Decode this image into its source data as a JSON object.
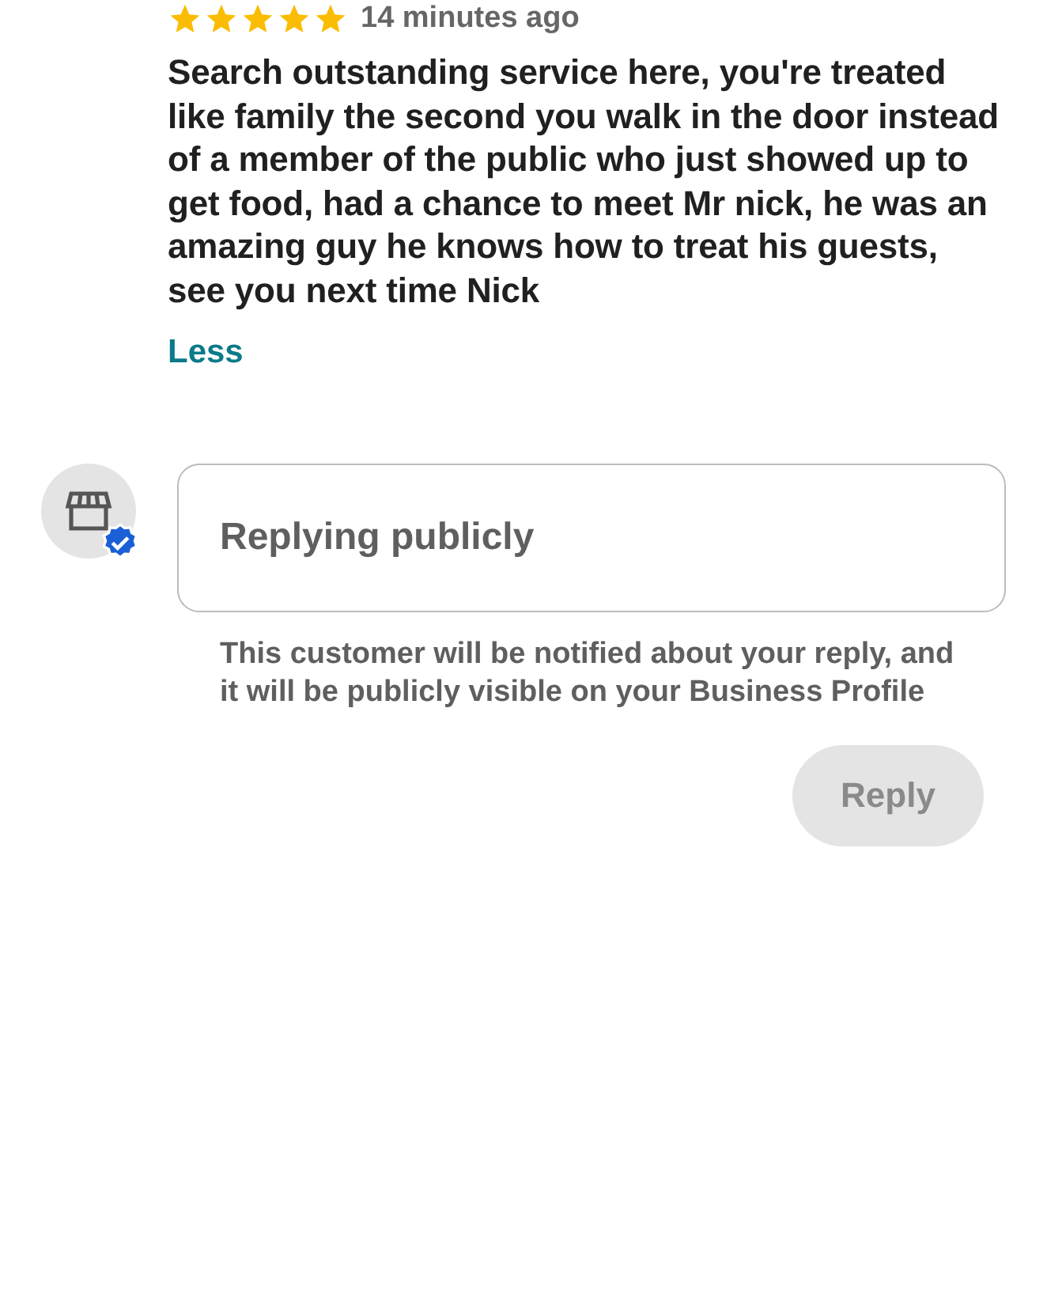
{
  "review": {
    "stars": 5,
    "time": "14 minutes ago",
    "text": "Search outstanding service here, you're treated like family the second you walk in the door instead of a member of the public who just showed up to get food, had a chance to meet Mr nick, he was an amazing guy he knows how to treat his guests, see you next time Nick",
    "toggle": "Less"
  },
  "reply": {
    "verified": true,
    "placeholder": "Replying publicly",
    "notice": "This customer will be notified about your reply, and it will be publicly visible on your Business Profile",
    "button": {
      "label": "Reply",
      "disabled": true
    }
  }
}
